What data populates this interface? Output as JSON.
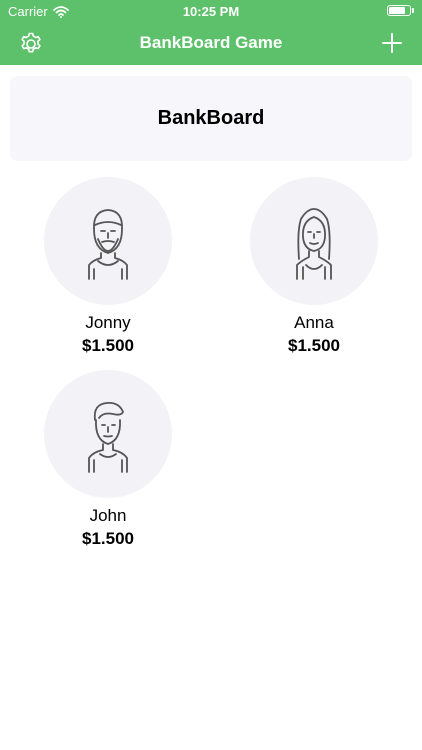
{
  "status_bar": {
    "carrier": "Carrier",
    "time": "10:25 PM",
    "battery_level": 0.8
  },
  "nav": {
    "title": "BankBoard Game",
    "left_icon": "gear-icon",
    "right_icon": "plus-icon"
  },
  "board": {
    "title": "BankBoard"
  },
  "players": [
    {
      "name": "Jonny",
      "balance": "$1.500",
      "avatar": "bearded-man-icon"
    },
    {
      "name": "Anna",
      "balance": "$1.500",
      "avatar": "woman-long-hair-icon"
    },
    {
      "name": "John",
      "balance": "$1.500",
      "avatar": "man-icon"
    }
  ],
  "colors": {
    "accent": "#5CC16A",
    "card_bg": "#F6F6FB",
    "avatar_bg": "#F2F2F7",
    "icon_stroke": "#555555"
  }
}
